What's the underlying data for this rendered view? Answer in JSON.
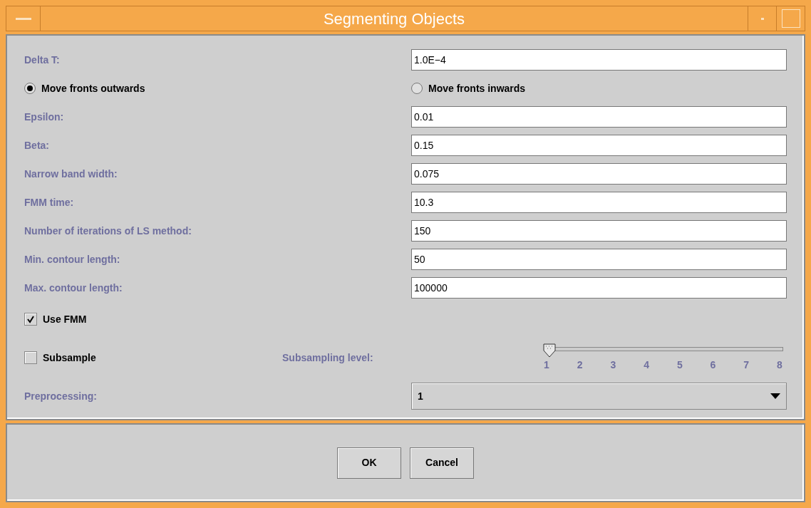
{
  "window": {
    "title": "Segmenting Objects"
  },
  "rows": [
    {
      "kind": "field",
      "label": "Delta T:",
      "value": "1.0E−4"
    },
    {
      "kind": "radios",
      "options": [
        {
          "label": "Move fronts outwards",
          "selected": true
        },
        {
          "label": "Move fronts inwards",
          "selected": false
        }
      ]
    },
    {
      "kind": "field",
      "label": "Epsilon:",
      "value": "0.01"
    },
    {
      "kind": "field",
      "label": "Beta:",
      "value": "0.15"
    },
    {
      "kind": "field",
      "label": "Narrow band width:",
      "value": "0.075"
    },
    {
      "kind": "field",
      "label": "FMM time:",
      "value": "10.3"
    },
    {
      "kind": "field",
      "label": "Number of iterations of LS method:",
      "value": "150"
    },
    {
      "kind": "field",
      "label": "Min. contour length:",
      "value": "50"
    },
    {
      "kind": "field",
      "label": "Max. contour length:",
      "value": "100000"
    },
    {
      "kind": "checkbox",
      "label": "Use FMM",
      "checked": true
    },
    {
      "kind": "checkbox_slider",
      "label": "Subsample",
      "checked": false,
      "slider_label": "Subsampling level:",
      "level": 0,
      "ticks": [
        "1",
        "2",
        "3",
        "4",
        "5",
        "6",
        "7",
        "8"
      ]
    },
    {
      "kind": "select",
      "label": "Preprocessing:",
      "value": "1"
    }
  ],
  "buttons": [
    "OK",
    "Cancel"
  ]
}
